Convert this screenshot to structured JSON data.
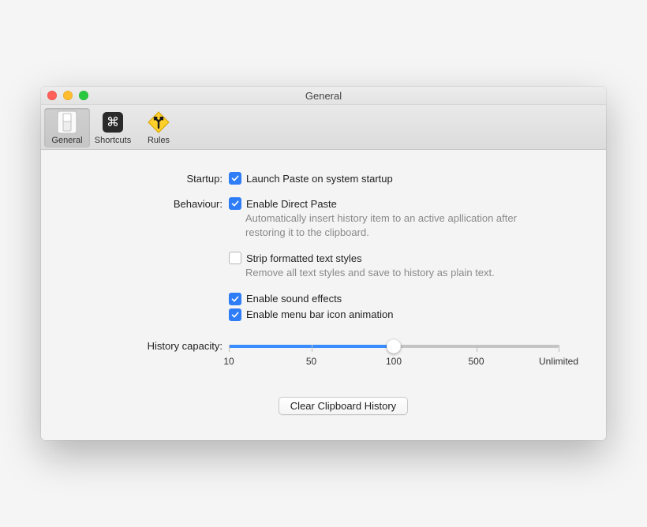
{
  "window": {
    "title": "General"
  },
  "toolbar": {
    "items": [
      {
        "label": "General",
        "selected": true
      },
      {
        "label": "Shortcuts",
        "selected": false
      },
      {
        "label": "Rules",
        "selected": false
      }
    ]
  },
  "labels": {
    "startup": "Startup:",
    "behaviour": "Behaviour:",
    "history_capacity": "History capacity:"
  },
  "options": {
    "launch_on_startup": {
      "label": "Launch Paste on system startup",
      "checked": true
    },
    "enable_direct_paste": {
      "label": "Enable Direct Paste",
      "checked": true,
      "desc": "Automatically insert history item to an active apllication after restoring it to the clipboard."
    },
    "strip_formatted": {
      "label": "Strip formatted text styles",
      "checked": false,
      "desc": "Remove all text styles and save to history as plain text."
    },
    "enable_sound": {
      "label": "Enable sound effects",
      "checked": true
    },
    "enable_menu_anim": {
      "label": "Enable menu bar icon animation",
      "checked": true
    }
  },
  "slider": {
    "ticks": [
      "10",
      "50",
      "100",
      "500",
      "Unlimited"
    ],
    "value_index": 2
  },
  "buttons": {
    "clear_history": "Clear Clipboard History"
  }
}
